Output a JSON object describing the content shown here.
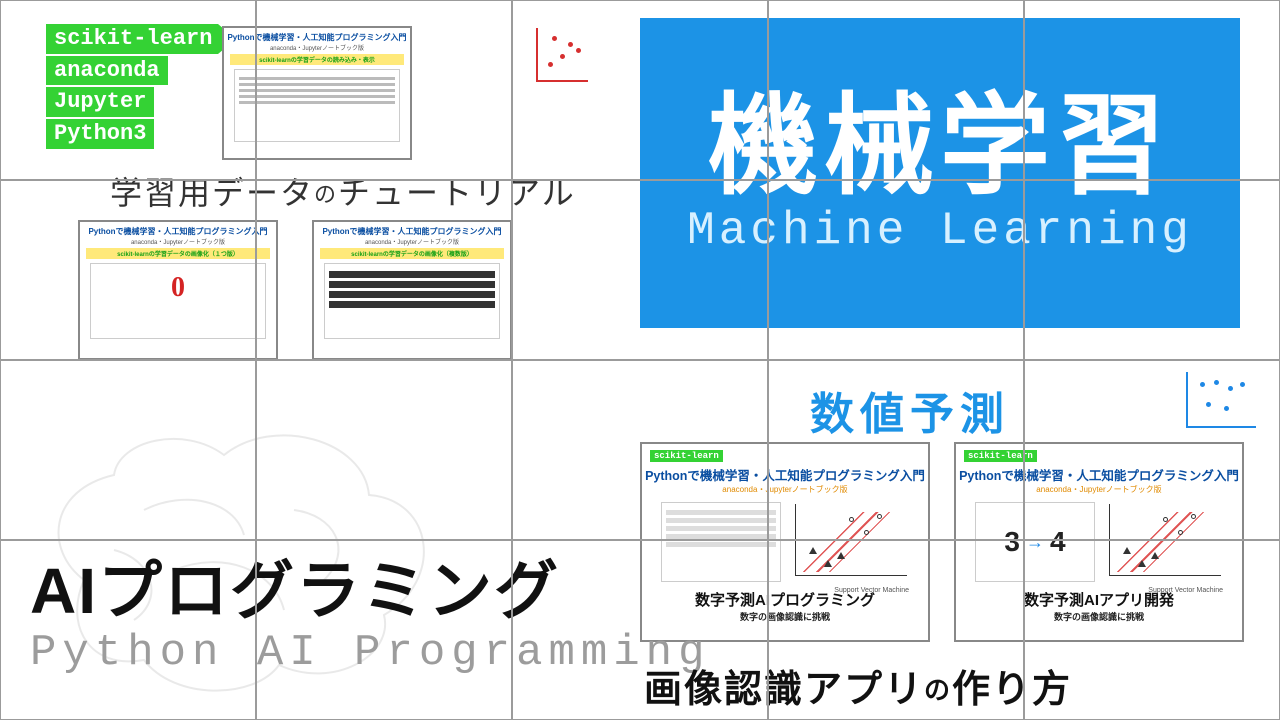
{
  "colors": {
    "green": "#34d234",
    "blue": "#1c93e6",
    "red": "#d62f2f"
  },
  "tags": [
    "scikit-learn",
    "anaconda",
    "Jupyter",
    "Python3"
  ],
  "tutorial": {
    "heading_a": "学習用データ",
    "heading_no": "の",
    "heading_b": "チュートリアル"
  },
  "thumbs_tl": {
    "common_title": "Pythonで機械学習・人工知能プログラミング入門",
    "common_sub": "anaconda・Jupyterノートブック版",
    "a_highlight": "scikit-learnの学習データの読み込み・表示",
    "b_highlight": "scikit-learnの学習データの画像化（１つ版）",
    "c_highlight": "scikit-learnの学習データの画像化（複数版）"
  },
  "ml_panel": {
    "jp": "機械学習",
    "en": "Machine Learning"
  },
  "subhead_blue": "数値予測",
  "thumbs_br": {
    "mini_tag": "scikit-learn",
    "title": "Pythonで機械学習・人工知能プログラミング入門",
    "sub": "anaconda・Jupyterノートブック版",
    "svm_label": "Support Vector Machine",
    "d_footer": "数字予測AIプログラミング",
    "d_footer2": "数字の画像認識に挑戦",
    "e_footer": "数字予測AIアプリ開発",
    "e_footer2": "数字の画像認識に挑戦",
    "digits": {
      "from": "3",
      "to": "4"
    }
  },
  "ai": {
    "title": "AIプログラミング",
    "sub": "Python AI Programming"
  },
  "bottom_right": {
    "a": "画像認識アプリ",
    "no": "の",
    "b": "作り方"
  }
}
